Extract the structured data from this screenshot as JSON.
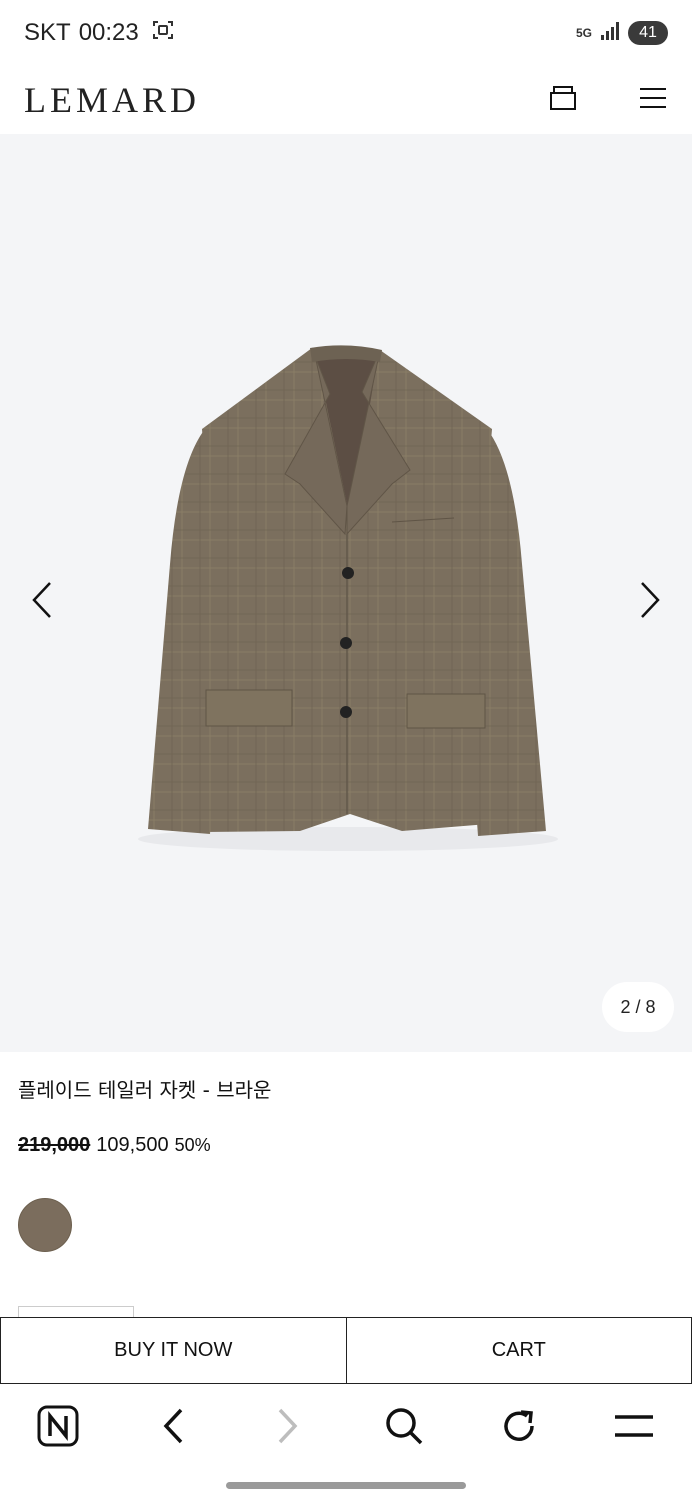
{
  "status_bar": {
    "carrier": "SKT",
    "time": "00:23",
    "network": "5G",
    "battery": "41"
  },
  "header": {
    "logo": "LEMARD",
    "icons": [
      "cart-bag-icon",
      "menu-icon"
    ]
  },
  "gallery": {
    "counter": "2 / 8",
    "current_index": 2,
    "total": 8,
    "icons": [
      "chevron-left-icon",
      "chevron-right-icon"
    ]
  },
  "product": {
    "name": "플레이드 테일러 자켓 - 브라운",
    "price_original": "219,000",
    "price_sale": "109,500",
    "discount": "50%",
    "swatch_color": "#7b6d5d"
  },
  "actions": {
    "buy_now": "BUY IT NOW",
    "cart": "CART"
  },
  "browser": {
    "icons": [
      "naver-icon",
      "back-icon",
      "forward-icon",
      "search-icon",
      "refresh-icon",
      "menu-icon"
    ]
  }
}
